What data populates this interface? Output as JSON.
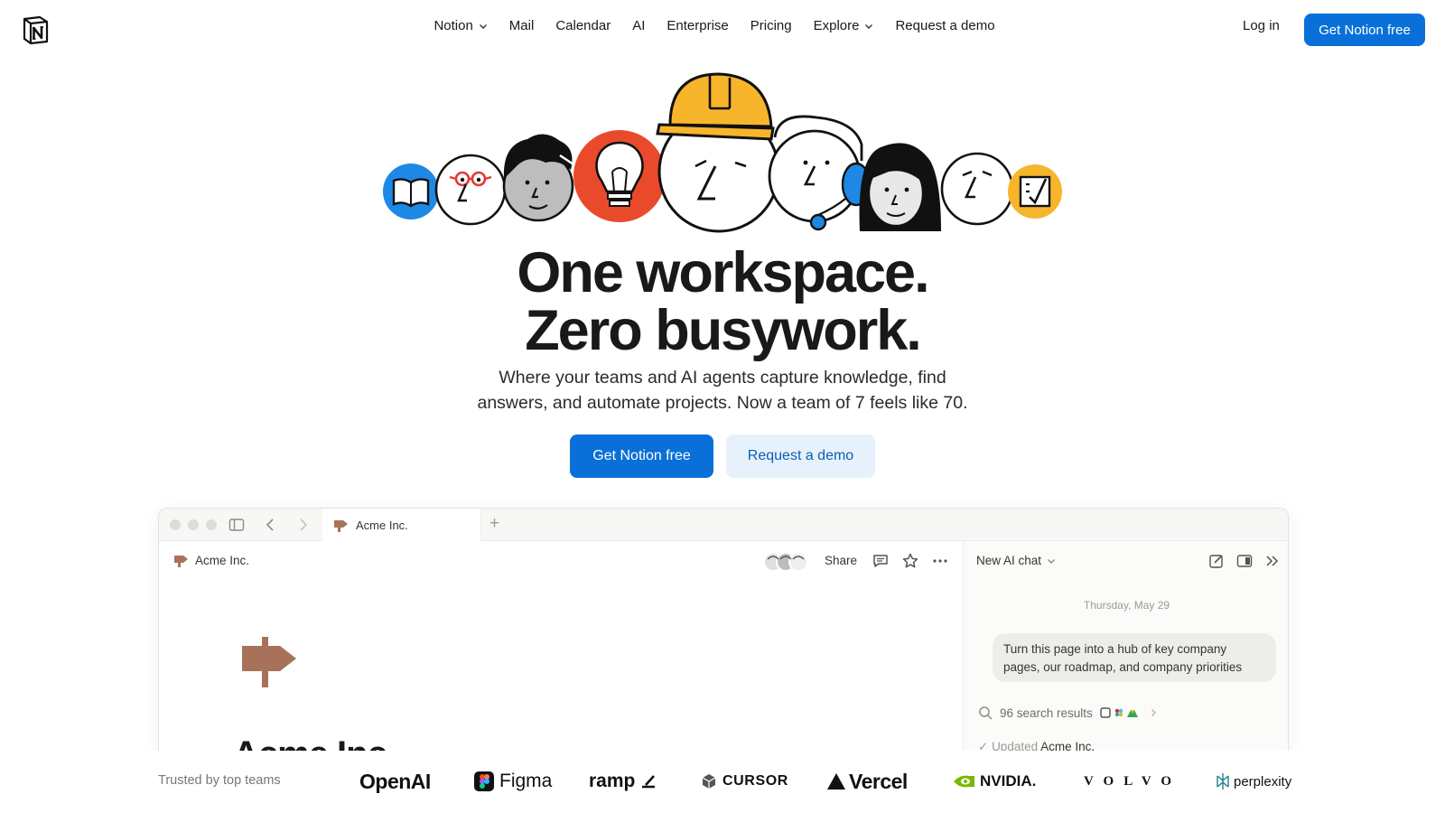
{
  "nav": {
    "links": [
      {
        "label": "Notion",
        "dropdown": true
      },
      {
        "label": "Mail",
        "dropdown": false
      },
      {
        "label": "Calendar",
        "dropdown": false
      },
      {
        "label": "AI",
        "dropdown": false
      },
      {
        "label": "Enterprise",
        "dropdown": false
      },
      {
        "label": "Pricing",
        "dropdown": false
      },
      {
        "label": "Explore",
        "dropdown": true
      },
      {
        "label": "Request a demo",
        "dropdown": false
      }
    ],
    "login": "Log in",
    "cta": "Get Notion free"
  },
  "hero": {
    "headline_line1": "One workspace.",
    "headline_line2": "Zero busywork.",
    "sub_line1": "Where your teams and AI agents capture knowledge, find",
    "sub_line2": "answers, and automate projects. Now a team of 7 feels like 70.",
    "primary_cta": "Get Notion free",
    "secondary_cta": "Request a demo"
  },
  "app": {
    "tab_title": "Acme Inc.",
    "breadcrumb": "Acme Inc.",
    "share": "Share",
    "page_title": "Acme Inc.",
    "ai": {
      "title": "New AI chat",
      "date": "Thursday, May 29",
      "message_line1": "Turn this page into a hub of key company",
      "message_line2": "pages, our roadmap, and company priorities",
      "search_results": "96 search results",
      "updated_prefix": "Updated",
      "updated_target": "Acme Inc."
    }
  },
  "trusted": {
    "label": "Trusted by top teams",
    "brands": [
      "OpenAI",
      "Figma",
      "ramp",
      "CURSOR",
      "Vercel",
      "NVIDIA.",
      "VOLVO",
      "perplexity"
    ]
  },
  "colors": {
    "accent": "#0a70d9",
    "accent_soft": "#e6f1fc",
    "sign_brown": "#a8725a",
    "lightbulb_red": "#ea4a2c",
    "hardhat_yellow": "#f7b52c",
    "book_blue": "#1e88e5"
  }
}
